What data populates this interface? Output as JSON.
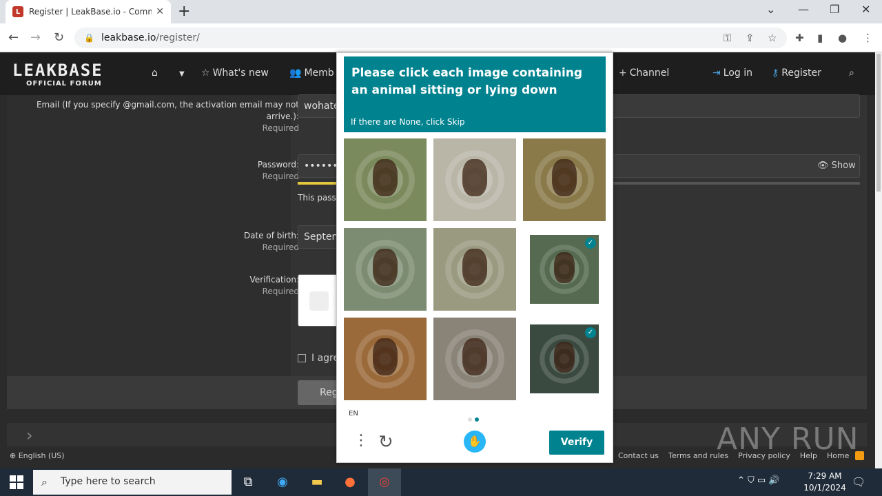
{
  "browser": {
    "tab_title": "Register | LeakBase.io - Commun",
    "tab_favicon_letter": "L",
    "url_domain": "leakbase.io",
    "url_path": "/register/"
  },
  "site": {
    "logo_main": "LEAKBASE",
    "logo_sub": "OFFICIAL FORUM",
    "nav": [
      {
        "label": "What's new",
        "icon": "star-icon"
      },
      {
        "label": "Memb",
        "icon": "members-icon"
      },
      {
        "label": "Channel",
        "icon": "plus-icon"
      },
      {
        "label": "Log in",
        "icon": "login-icon"
      },
      {
        "label": "Register",
        "icon": "key-icon"
      }
    ]
  },
  "form": {
    "email_label": "Email (If you specify @gmail.com, the activation email may not arrive.):",
    "email_value": "wohate",
    "password_label": "Password:",
    "password_value": "••••••••••",
    "password_hint": "This pass",
    "show_label": "Show",
    "dob_label": "Date of birth:",
    "dob_value": "Septen",
    "verification_label": "Verification:",
    "required": "Required",
    "agree_label": "I agre",
    "register_btn": "Reg"
  },
  "captcha": {
    "question": "Please click each image containing an animal sitting or lying down",
    "hint": "If there are None, click Skip",
    "language": "EN",
    "verify_label": "Verify",
    "images": [
      {
        "selected": false,
        "color": "#7a8a5c"
      },
      {
        "selected": false,
        "color": "#b9b6a8"
      },
      {
        "selected": false,
        "color": "#8a7a4a"
      },
      {
        "selected": false,
        "color": "#7c8c72"
      },
      {
        "selected": false,
        "color": "#9a9a80"
      },
      {
        "selected": true,
        "color": "#556a50"
      },
      {
        "selected": false,
        "color": "#9a6a3a"
      },
      {
        "selected": false,
        "color": "#8a8478"
      },
      {
        "selected": true,
        "color": "#3a4a40"
      }
    ]
  },
  "footer": {
    "language": "English (US)",
    "links": [
      "Contact us",
      "Terms and rules",
      "Privacy policy",
      "Help",
      "Home"
    ]
  },
  "watermark": "ANY RUN",
  "taskbar": {
    "search_placeholder": "Type here to search",
    "time": "7:29 AM",
    "date": "10/1/2024"
  }
}
